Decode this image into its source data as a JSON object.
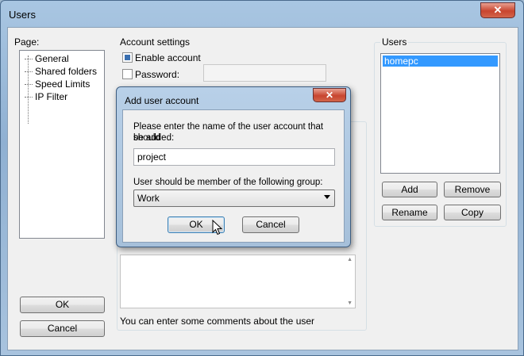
{
  "window": {
    "title": "Users",
    "close_glyph": "✕"
  },
  "page": {
    "label": "Page:",
    "items": [
      "General",
      "Shared folders",
      "Speed Limits",
      "IP Filter"
    ]
  },
  "account": {
    "label": "Account settings",
    "enable_label": "Enable account",
    "enable_checked": true,
    "password_label": "Password:",
    "password_checked": false,
    "password_value": "",
    "comments_hint": "You can enter some comments about the user"
  },
  "users": {
    "label": "Users",
    "items": [
      "homepc"
    ],
    "selected": "homepc",
    "add_label": "Add",
    "remove_label": "Remove",
    "rename_label": "Rename",
    "copy_label": "Copy"
  },
  "buttons": {
    "ok_label": "OK",
    "cancel_label": "Cancel"
  },
  "dialog": {
    "title": "Add user account",
    "close_glyph": "✕",
    "prompt_line1": "Please enter the name of the user account that should",
    "prompt_line2": "be added:",
    "name_value": "project",
    "group_prompt": "User should be member of the following group:",
    "group_value": "Work",
    "ok_label": "OK",
    "cancel_label": "Cancel"
  },
  "icons": {
    "cursor": "mouse-pointer-icon",
    "dropdown": "chevron-down-icon"
  }
}
